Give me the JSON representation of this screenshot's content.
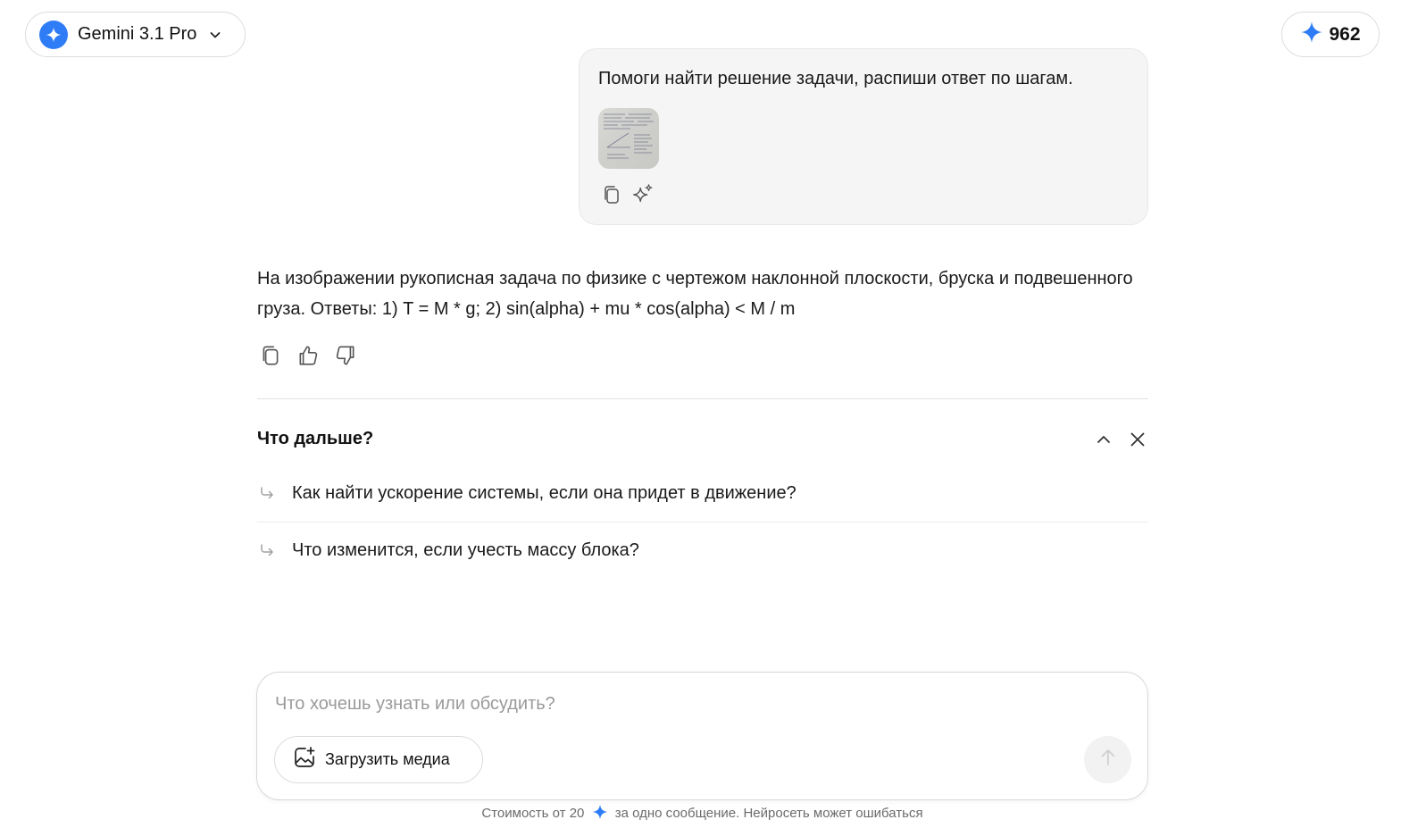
{
  "header": {
    "model_name": "Gemini 3.1 Pro",
    "credits": "962"
  },
  "user_message": {
    "text": "Помоги найти решение задачи, распиши ответ по шагам."
  },
  "assistant_message": {
    "text": "На изображении рукописная задача по физике с чертежом наклонной плоскости, бруска и подвешенного груза. Ответы: 1) T = M * g; 2) sin(alpha) + mu * cos(alpha) < M / m"
  },
  "next": {
    "title": "Что дальше?",
    "suggestions": [
      "Как найти ускорение системы, если она придет в движение?",
      "Что изменится, если учесть массу блока?"
    ]
  },
  "composer": {
    "placeholder": "Что хочешь узнать или обсудить?",
    "value": "",
    "upload_label": "Загрузить медиа"
  },
  "footer": {
    "prefix": "Стоимость от 20",
    "suffix": "за одно сообщение. Нейросеть может ошибаться"
  },
  "icons": {
    "model_logo": "sparkle-icon",
    "chevron": "chevron-down-icon",
    "credits": "sparkle-icon",
    "copy": "copy-icon",
    "improve": "sparkles-icon",
    "like": "thumbs-up-icon",
    "dislike": "thumbs-down-icon",
    "collapse": "chevron-up-icon",
    "close": "close-icon",
    "suggestion": "arrow-turn-right-icon",
    "upload": "image-add-icon",
    "send": "arrow-up-icon"
  },
  "colors": {
    "accent": "#2f7df6",
    "bubble_bg": "#f5f5f5",
    "muted_text": "#6b6b6b"
  }
}
